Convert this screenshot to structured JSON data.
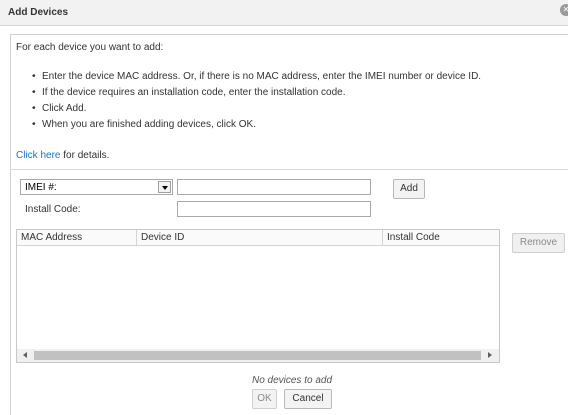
{
  "dialog": {
    "title": "Add Devices",
    "close_icon": "close-icon"
  },
  "intro": "For each device you want to add:",
  "instructions": [
    "Enter the device MAC address. Or, if there is no MAC address, enter the IMEI number or device ID.",
    "If the device requires an installation code, enter the installation code.",
    "Click Add.",
    "When you are finished adding devices, click OK."
  ],
  "details": {
    "link_text": "Click here",
    "suffix": " for details."
  },
  "form": {
    "id_type_selected": "IMEI #:",
    "id_value": "",
    "install_code_label": "Install Code:",
    "install_code_value": "",
    "add_label": "Add"
  },
  "table": {
    "columns": [
      "MAC Address",
      "Device ID",
      "Install Code"
    ],
    "rows": [],
    "remove_label": "Remove"
  },
  "status": "No devices to add",
  "footer": {
    "ok_label": "OK",
    "cancel_label": "Cancel"
  }
}
